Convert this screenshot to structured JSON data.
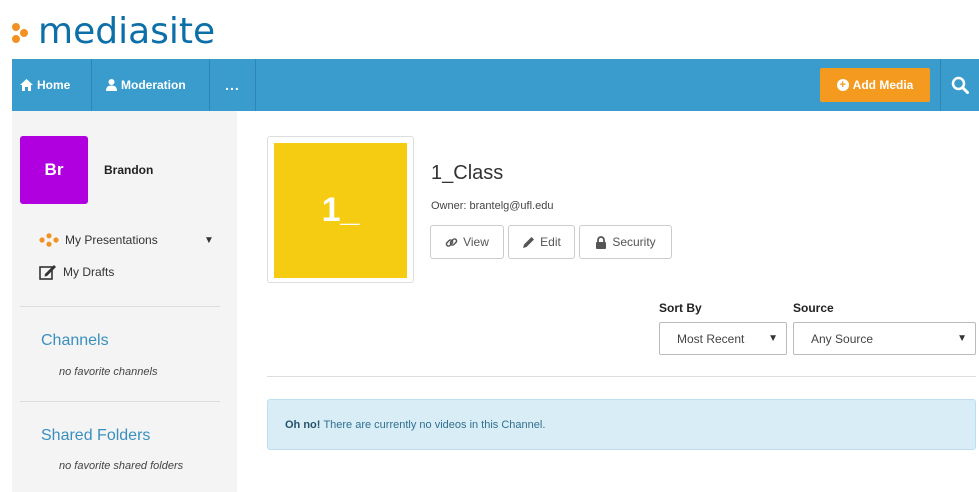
{
  "logo": {
    "text": "mediasite"
  },
  "navbar": {
    "home_label": "Home",
    "moderation_label": "Moderation",
    "more_label": "...",
    "add_media_label": "Add Media",
    "accent_color": "#3a9ccc",
    "add_media_color": "#f49a1f"
  },
  "sidebar": {
    "avatar_initials": "Br",
    "avatar_color": "#b000e0",
    "user_name": "Brandon",
    "my_presentations_label": "My Presentations",
    "my_drafts_label": "My Drafts",
    "channels_heading": "Channels",
    "channels_empty": "no favorite channels",
    "shared_folders_heading": "Shared Folders",
    "shared_folders_empty": "no favorite shared folders"
  },
  "channel": {
    "thumbnail_text": "1_",
    "thumbnail_color": "#f5cc11",
    "title": "1_Class",
    "owner": "Owner: brantelg@ufl.edu",
    "view_label": "View",
    "edit_label": "Edit",
    "security_label": "Security"
  },
  "filters": {
    "sort_label": "Sort By",
    "sort_value": "Most Recent",
    "source_label": "Source",
    "source_value": "Any Source"
  },
  "alert": {
    "strong": "Oh no!",
    "message": "There are currently no videos in this Channel."
  }
}
